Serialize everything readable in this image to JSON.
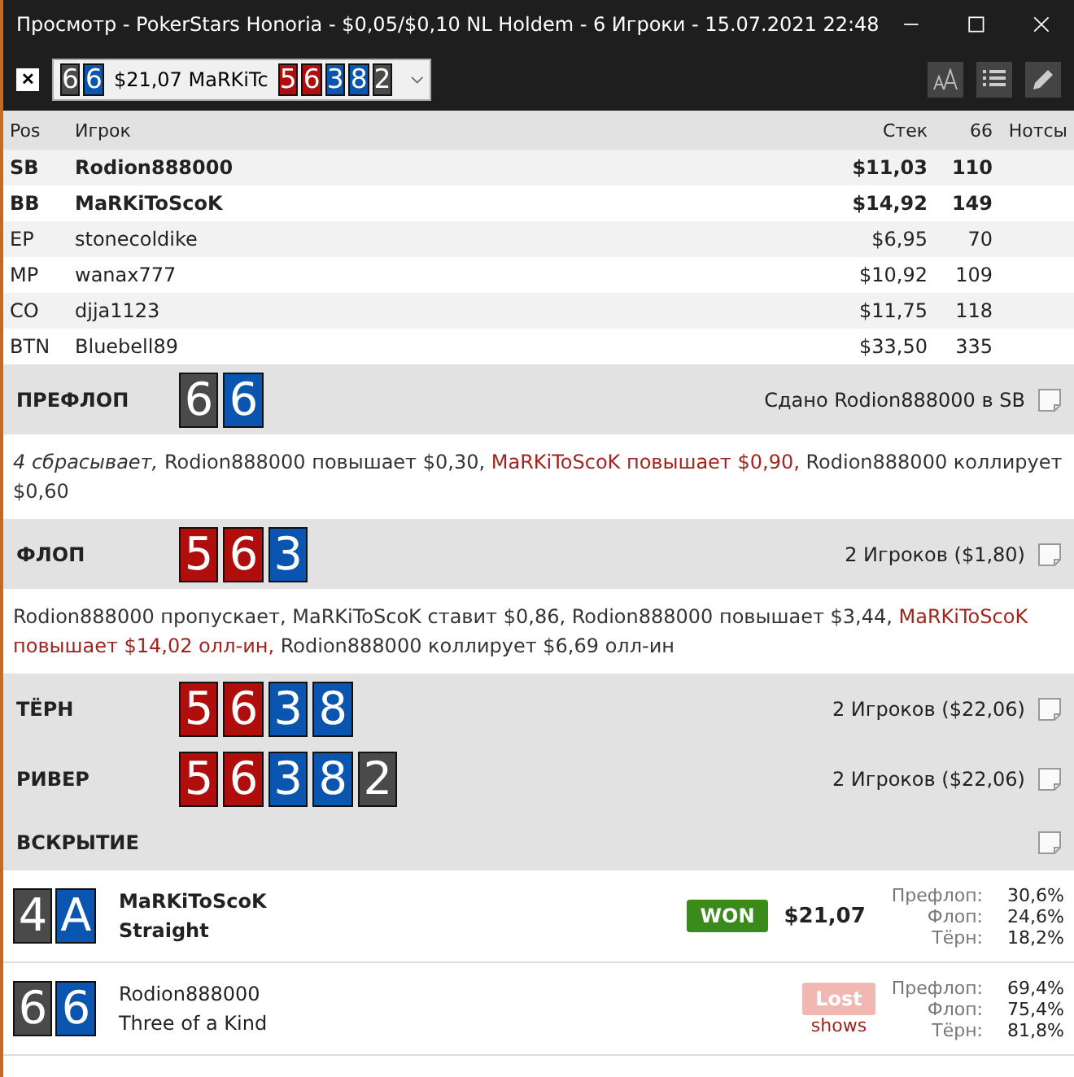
{
  "window": {
    "title": "Просмотр - PokerStars Honoria - $0,05/$0,10 NL Holdem - 6 Игроки - 15.07.2021 22:48"
  },
  "toolbar": {
    "close": "✕",
    "selector": {
      "hole": [
        {
          "rank": "6",
          "color": "#4a4a4a"
        },
        {
          "rank": "6",
          "color": "#0a55b0"
        }
      ],
      "text": "$21,07 MaRKiTc",
      "board": [
        {
          "rank": "5",
          "color": "#b00d0d"
        },
        {
          "rank": "6",
          "color": "#b00d0d"
        },
        {
          "rank": "3",
          "color": "#0a55b0"
        },
        {
          "rank": "8",
          "color": "#0a55b0"
        },
        {
          "rank": "2",
          "color": "#4a4a4a"
        }
      ]
    }
  },
  "table": {
    "columns": [
      "Pos",
      "Игрок",
      "Стек",
      "66",
      "Нотсы"
    ],
    "rows": [
      {
        "pos": "SB",
        "player": "Rodion888000",
        "stack": "$11,03",
        "bb": "110",
        "bold": true
      },
      {
        "pos": "BB",
        "player": "MaRKiToScoK",
        "stack": "$14,92",
        "bb": "149",
        "bold": true
      },
      {
        "pos": "EP",
        "player": "stonecoldike",
        "stack": "$6,95",
        "bb": "70",
        "bold": false
      },
      {
        "pos": "MP",
        "player": "wanax777",
        "stack": "$10,92",
        "bb": "109",
        "bold": false
      },
      {
        "pos": "CO",
        "player": "djja1123",
        "stack": "$11,75",
        "bb": "118",
        "bold": false
      },
      {
        "pos": "BTN",
        "player": "Bluebell89",
        "stack": "$33,50",
        "bb": "335",
        "bold": false
      }
    ]
  },
  "streets": [
    {
      "name": "ПРЕФЛОП",
      "cards": [
        {
          "rank": "6",
          "color": "#4a4a4a"
        },
        {
          "rank": "6",
          "color": "#0a55b0"
        }
      ],
      "info": "Сдано Rodion888000 в SB",
      "actions": [
        {
          "kind": "fold",
          "text": "4 сбрасывает,"
        },
        {
          "kind": "normal",
          "text": "Rodion888000 повышает $0,30,"
        },
        {
          "kind": "hero",
          "text": "MaRKiToScoK повышает $0,90,"
        },
        {
          "kind": "normal",
          "text": "Rodion888000 коллирует $0,60"
        }
      ]
    },
    {
      "name": "ФЛОП",
      "cards": [
        {
          "rank": "5",
          "color": "#b00d0d"
        },
        {
          "rank": "6",
          "color": "#b00d0d"
        },
        {
          "rank": "3",
          "color": "#0a55b0"
        }
      ],
      "info": "2 Игроков ($1,80)",
      "actions": [
        {
          "kind": "normal",
          "text": "Rodion888000 пропускает, MaRKiToScoK ставит $0,86, Rodion888000 повышает $3,44,"
        },
        {
          "kind": "hero",
          "text": "MaRKiToScoK повышает $14,02 олл-ин,"
        },
        {
          "kind": "normal",
          "text": "Rodion888000 коллирует $6,69 олл-ин"
        }
      ]
    },
    {
      "name": "ТЁРН",
      "cards": [
        {
          "rank": "5",
          "color": "#b00d0d"
        },
        {
          "rank": "6",
          "color": "#b00d0d"
        },
        {
          "rank": "3",
          "color": "#0a55b0"
        },
        {
          "rank": "8",
          "color": "#0a55b0"
        }
      ],
      "info": "2 Игроков ($22,06)"
    },
    {
      "name": "РИВЕР",
      "cards": [
        {
          "rank": "5",
          "color": "#b00d0d"
        },
        {
          "rank": "6",
          "color": "#b00d0d"
        },
        {
          "rank": "3",
          "color": "#0a55b0"
        },
        {
          "rank": "8",
          "color": "#0a55b0"
        },
        {
          "rank": "2",
          "color": "#4a4a4a"
        }
      ],
      "info": "2 Игроков ($22,06)"
    },
    {
      "name": "ВСКРЫТИЕ"
    }
  ],
  "showdown": [
    {
      "cards": [
        {
          "rank": "4",
          "color": "#4a4a4a"
        },
        {
          "rank": "A",
          "color": "#0a55b0"
        }
      ],
      "player": "MaRKiToScoK",
      "hand": "Straight",
      "bold": true,
      "result": "WON",
      "won": true,
      "amount": "$21,07",
      "equity": [
        {
          "label": "Префлоп:",
          "value": "30,6%"
        },
        {
          "label": "Флоп:",
          "value": "24,6%"
        },
        {
          "label": "Тёрн:",
          "value": "18,2%"
        }
      ]
    },
    {
      "cards": [
        {
          "rank": "6",
          "color": "#4a4a4a"
        },
        {
          "rank": "6",
          "color": "#0a55b0"
        }
      ],
      "player": "Rodion888000",
      "hand": "Three of a Kind",
      "bold": false,
      "result": "Lost",
      "won": false,
      "note": "shows",
      "equity": [
        {
          "label": "Префлоп:",
          "value": "69,4%"
        },
        {
          "label": "Флоп:",
          "value": "75,4%"
        },
        {
          "label": "Тёрн:",
          "value": "81,8%"
        }
      ]
    }
  ]
}
